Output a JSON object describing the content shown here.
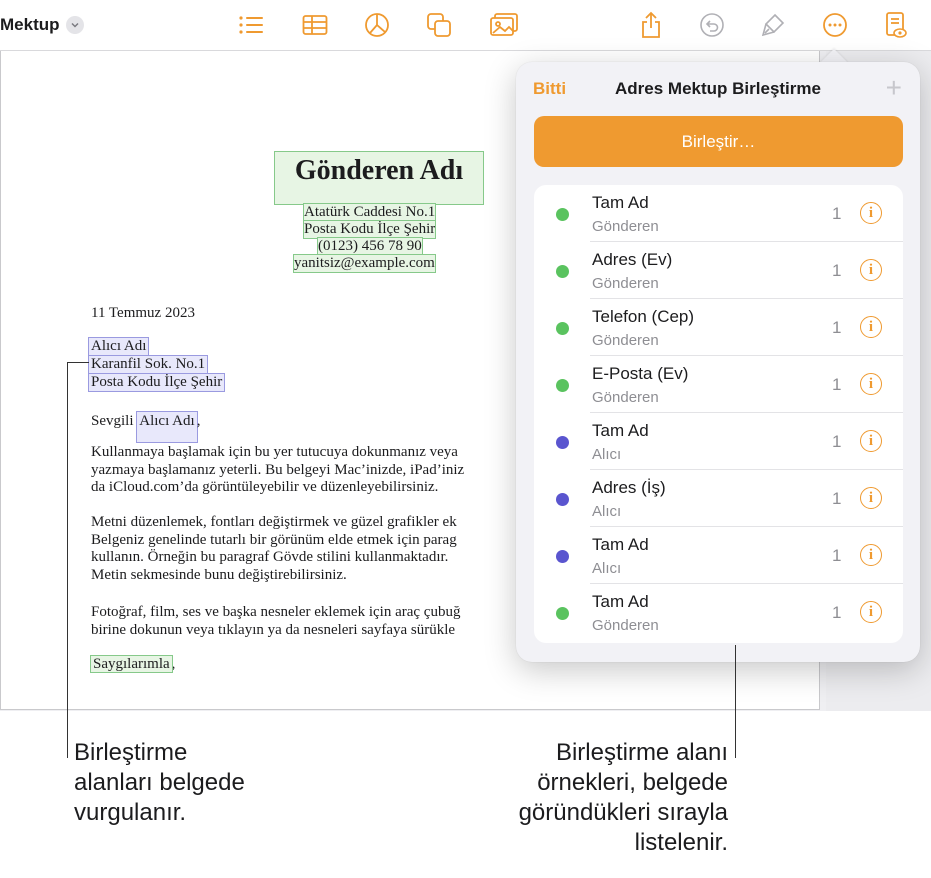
{
  "toolbar": {
    "doc_title": "Mektup",
    "icons": [
      "chevron-down-icon",
      "list-icon",
      "table-icon",
      "chart-icon",
      "shapes-icon",
      "media-icon",
      "share-icon",
      "undo-icon",
      "format-brush-icon",
      "more-icon",
      "reading-view-icon"
    ],
    "accent_color": "#ef9a30"
  },
  "document": {
    "sender_name": "Gönderen Adı",
    "sender_address": [
      "Atatürk Caddesi No.1",
      "Posta Kodu İlçe Şehir",
      "(0123) 456 78 90",
      "yanitsiz@example.com"
    ],
    "date": "11 Temmuz 2023",
    "recipient": [
      "Alıcı Adı",
      "Karanfil Sok. No.1",
      "Posta Kodu İlçe Şehir"
    ],
    "salutation_prefix": "Sevgili ",
    "salutation_field": "Alıcı Adı",
    "salutation_suffix": ",",
    "paragraph1": [
      "Kullanmaya başlamak için bu yer tutucuya dokunmanız veya",
      "yazmaya başlamanız yeterli. Bu belgeyi Mac’inizde, iPad’iniz",
      "da iCloud.com’da görüntüleyebilir ve düzenleyebilirsiniz."
    ],
    "paragraph2": [
      "Metni düzenlemek, fontları değiştirmek ve güzel grafikler ek",
      "Belgeniz genelinde tutarlı bir görünüm elde etmek için parag",
      "kullanın. Örneğin bu paragraf Gövde stilini kullanmaktadır.",
      "Metin sekmesinde bunu değiştirebilirsiniz."
    ],
    "paragraph3": [
      "Fotoğraf, film, ses ve başka nesneler eklemek için araç çubuğ",
      "birine dokunun veya tıklayın ya da nesneleri sayfaya sürükle"
    ],
    "closing_field": "Saygılarımla",
    "closing_suffix": ","
  },
  "panel": {
    "done_label": "Bitti",
    "title": "Adres Mektup Birleştirme",
    "add_label": "+",
    "merge_button_label": "Birleştir…",
    "sender_color": "#5ac35f",
    "recipient_color": "#5a55cf",
    "fields": [
      {
        "name": "Tam Ad",
        "source": "Gönderen",
        "count": "1",
        "kind": "sender"
      },
      {
        "name": "Adres (Ev)",
        "source": "Gönderen",
        "count": "1",
        "kind": "sender"
      },
      {
        "name": "Telefon (Cep)",
        "source": "Gönderen",
        "count": "1",
        "kind": "sender"
      },
      {
        "name": "E-Posta (Ev)",
        "source": "Gönderen",
        "count": "1",
        "kind": "sender"
      },
      {
        "name": "Tam Ad",
        "source": "Alıcı",
        "count": "1",
        "kind": "recipient"
      },
      {
        "name": "Adres (İş)",
        "source": "Alıcı",
        "count": "1",
        "kind": "recipient"
      },
      {
        "name": "Tam Ad",
        "source": "Alıcı",
        "count": "1",
        "kind": "recipient"
      },
      {
        "name": "Tam Ad",
        "source": "Gönderen",
        "count": "1",
        "kind": "sender"
      }
    ]
  },
  "callouts": {
    "left": [
      "Birleştirme",
      "alanları belgede",
      "vurgulanır."
    ],
    "right": [
      "Birleştirme alanı",
      "örnekleri, belgede",
      "göründükleri sırayla",
      "listelenir."
    ]
  }
}
